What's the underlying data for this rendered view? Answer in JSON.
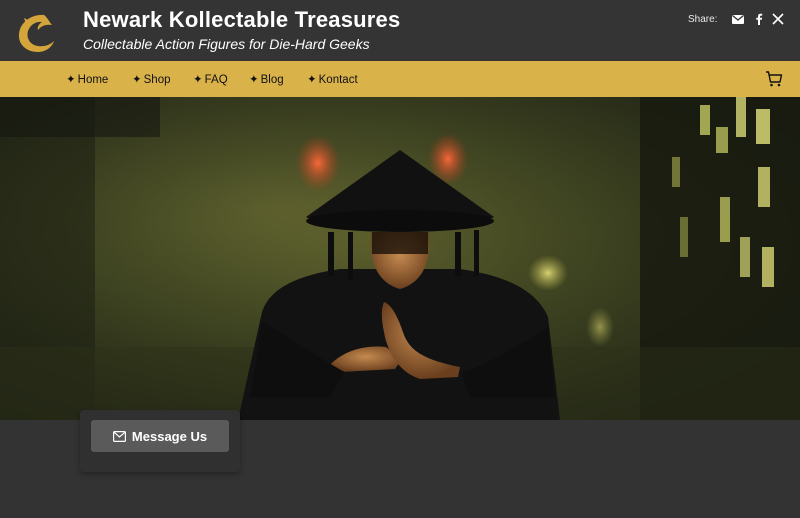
{
  "header": {
    "title": "Newark Kollectable Treasures",
    "tagline": "Collectable Action Figures for Die-Hard Geeks",
    "share_label": "Share:",
    "share_icons": [
      "email-icon",
      "facebook-icon",
      "x-icon"
    ]
  },
  "nav": {
    "items": [
      {
        "label": "Home"
      },
      {
        "label": "Shop"
      },
      {
        "label": "FAQ"
      },
      {
        "label": "Blog"
      },
      {
        "label": "Kontact"
      }
    ],
    "bullet": "✦",
    "cart_icon": "shopping-cart-icon"
  },
  "cta": {
    "label": "Message Us",
    "icon": "envelope-icon"
  },
  "colors": {
    "header_bg": "#343434",
    "nav_bg": "#dab24a",
    "page_bg": "#333333",
    "button_bg": "#5a5a5a",
    "logo_gold": "#d4a53a"
  }
}
